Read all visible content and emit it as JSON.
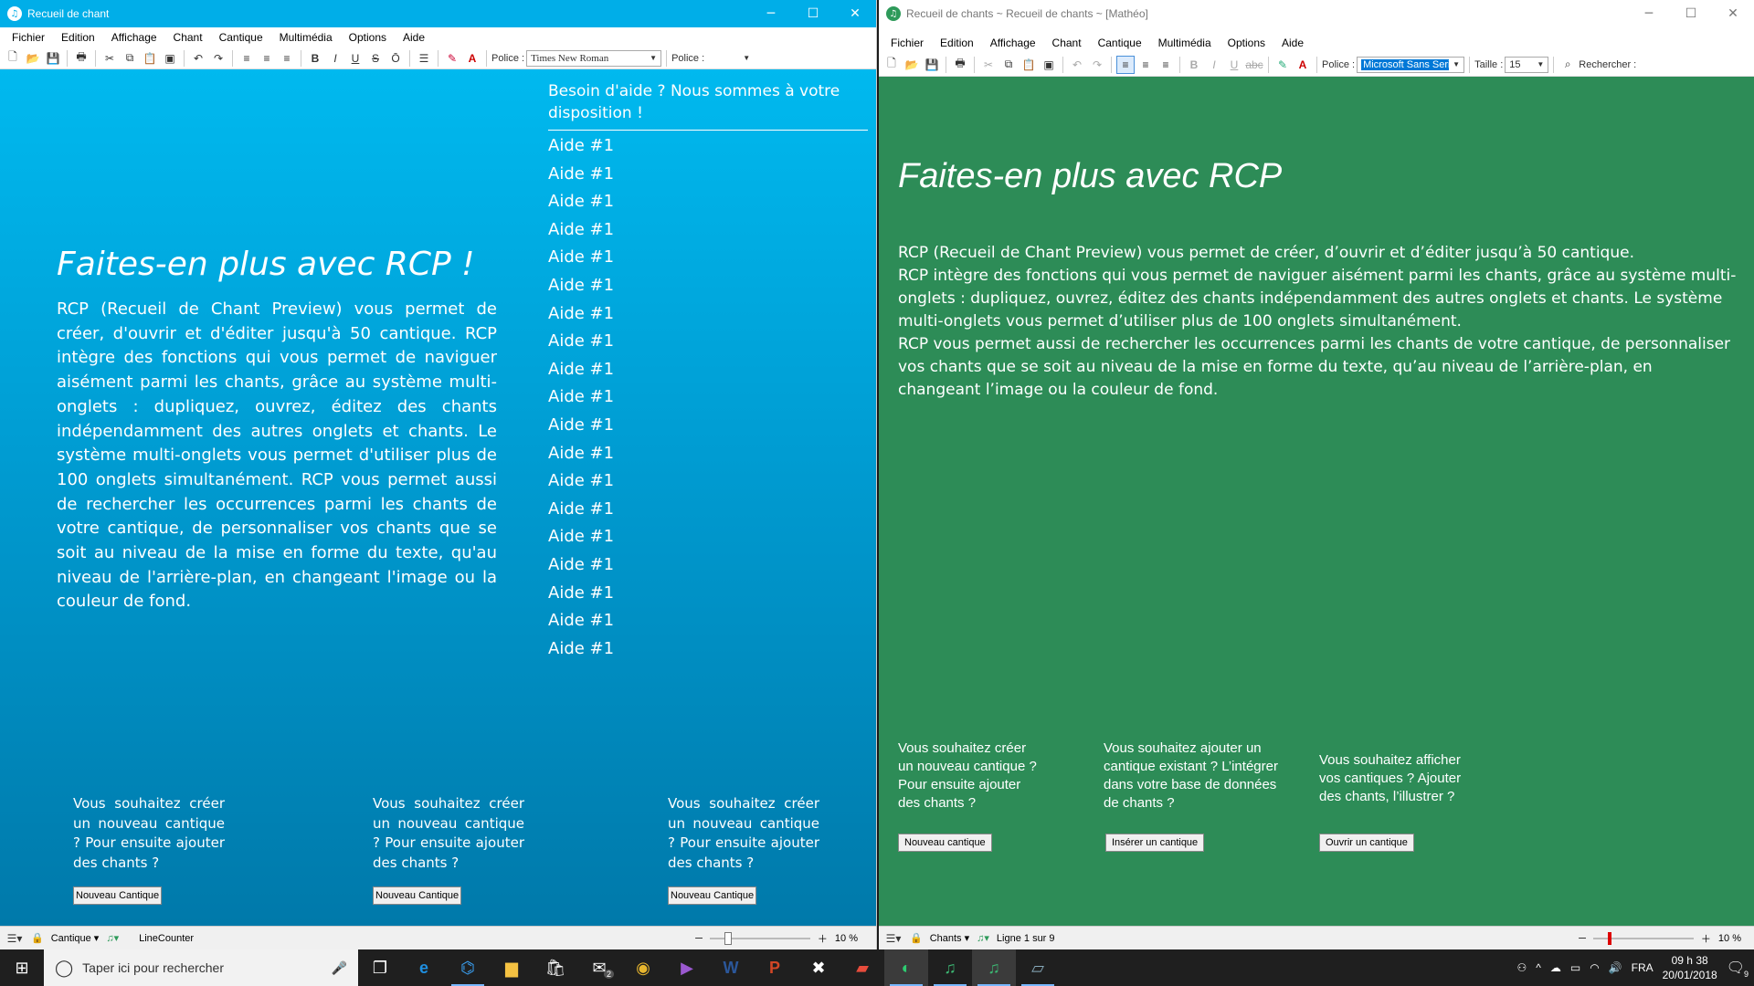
{
  "left": {
    "title": "Recueil de chant",
    "menu": [
      "Fichier",
      "Edition",
      "Affichage",
      "Chant",
      "Cantique",
      "Multimédia",
      "Options",
      "Aide"
    ],
    "toolbar": {
      "font_label": "Police :",
      "font_value": "Times New Roman",
      "font_label2": "Police :"
    },
    "heading": "Faites-en plus avec RCP !",
    "body": "RCP (Recueil de Chant Preview) vous permet de créer, d'ouvrir et d'éditer jusqu'à 50 cantique.   RCP intègre des fonctions qui vous permet de naviguer aisément parmi les chants, grâce au système multi-onglets : dupliquez, ouvrez, éditez des chants indépendamment des autres onglets et chants. Le système multi-onglets vous permet d'utiliser plus de 100 onglets simultanément. RCP vous permet aussi de rechercher les occurrences parmi les chants de votre cantique, de personnaliser vos chants que se soit au niveau de la mise en forme du texte, qu'au niveau de l'arrière-plan, en changeant l'image ou la couleur de fond.",
    "help_heading": "Besoin d'aide ? Nous sommes à votre disposition !",
    "help_items": [
      "Aide #1",
      "Aide #1",
      "Aide #1",
      "Aide #1",
      "Aide #1",
      "Aide #1",
      "Aide #1",
      "Aide #1",
      "Aide #1",
      "Aide #1",
      "Aide #1",
      "Aide #1",
      "Aide #1",
      "Aide #1",
      "Aide #1",
      "Aide #1",
      "Aide #1",
      "Aide #1",
      "Aide #1"
    ],
    "cards": [
      {
        "text": "Vous souhaitez créer un nouveau cantique ? Pour ensuite ajouter des chants ?",
        "button": "Nouveau Cantique"
      },
      {
        "text": "Vous souhaitez créer un nouveau cantique ? Pour ensuite ajouter des chants ?",
        "button": "Nouveau Cantique"
      },
      {
        "text": "Vous souhaitez créer un nouveau cantique ? Pour ensuite ajouter des chants ?",
        "button": "Nouveau Cantique"
      }
    ],
    "status": {
      "cantique": "Cantique",
      "counter": "LineCounter",
      "zoom": "10 %",
      "zoom_level": 0.15
    }
  },
  "right": {
    "title": "Recueil de chants ~ Recueil de chants ~ [Mathéo]",
    "menu": [
      "Fichier",
      "Edition",
      "Affichage",
      "Chant",
      "Cantique",
      "Multimédia",
      "Options",
      "Aide"
    ],
    "toolbar": {
      "font_label": "Police :",
      "font_value": "Microsoft Sans Serif",
      "size_label": "Taille :",
      "size_value": "15",
      "search_label": "Rechercher :"
    },
    "heading": "Faites-en plus avec RCP",
    "body_lines": [
      "RCP (Recueil de Chant Preview) vous permet de créer, d’ouvrir et d’éditer jusqu’à 50 cantique.",
      "RCP intègre des fonctions qui vous permet de naviguer aisément parmi les chants, grâce au système multi-onglets : dupliquez, ouvrez, éditez des chants indépendamment des autres onglets et chants. Le système multi-onglets vous permet d’utiliser plus de 100 onglets simultanément.",
      "RCP vous permet aussi de rechercher les occurrences parmi les chants de votre cantique, de personnaliser vos chants que se soit au niveau de la mise en forme du texte, qu’au niveau de l’arrière-plan, en changeant l’image ou la couleur de fond."
    ],
    "cards": [
      {
        "text": "Vous souhaitez créer un nouveau cantique ? Pour ensuite ajouter des chants ?",
        "button": "Nouveau cantique"
      },
      {
        "text": "Vous souhaitez ajouter un cantique existant ? L’intégrer dans votre base de données de chants ?",
        "button": "Insérer un cantique"
      },
      {
        "text": "Vous souhaitez afficher vos cantiques ? Ajouter des chants, l’illustrer ?",
        "button": "Ouvrir un cantique"
      }
    ],
    "status": {
      "chants": "Chants",
      "line": "Ligne 1 sur 9",
      "zoom": "10 %",
      "zoom_level": 0.15
    }
  },
  "taskbar": {
    "search_placeholder": "Taper ici pour rechercher",
    "lang": "FRA",
    "time": "09 h 38",
    "date": "20/01/2018",
    "mail_badge": "2",
    "notif_badge": "9"
  },
  "colors": {
    "left_bg": "#00aee8",
    "right_bg": "#2d8c57"
  }
}
